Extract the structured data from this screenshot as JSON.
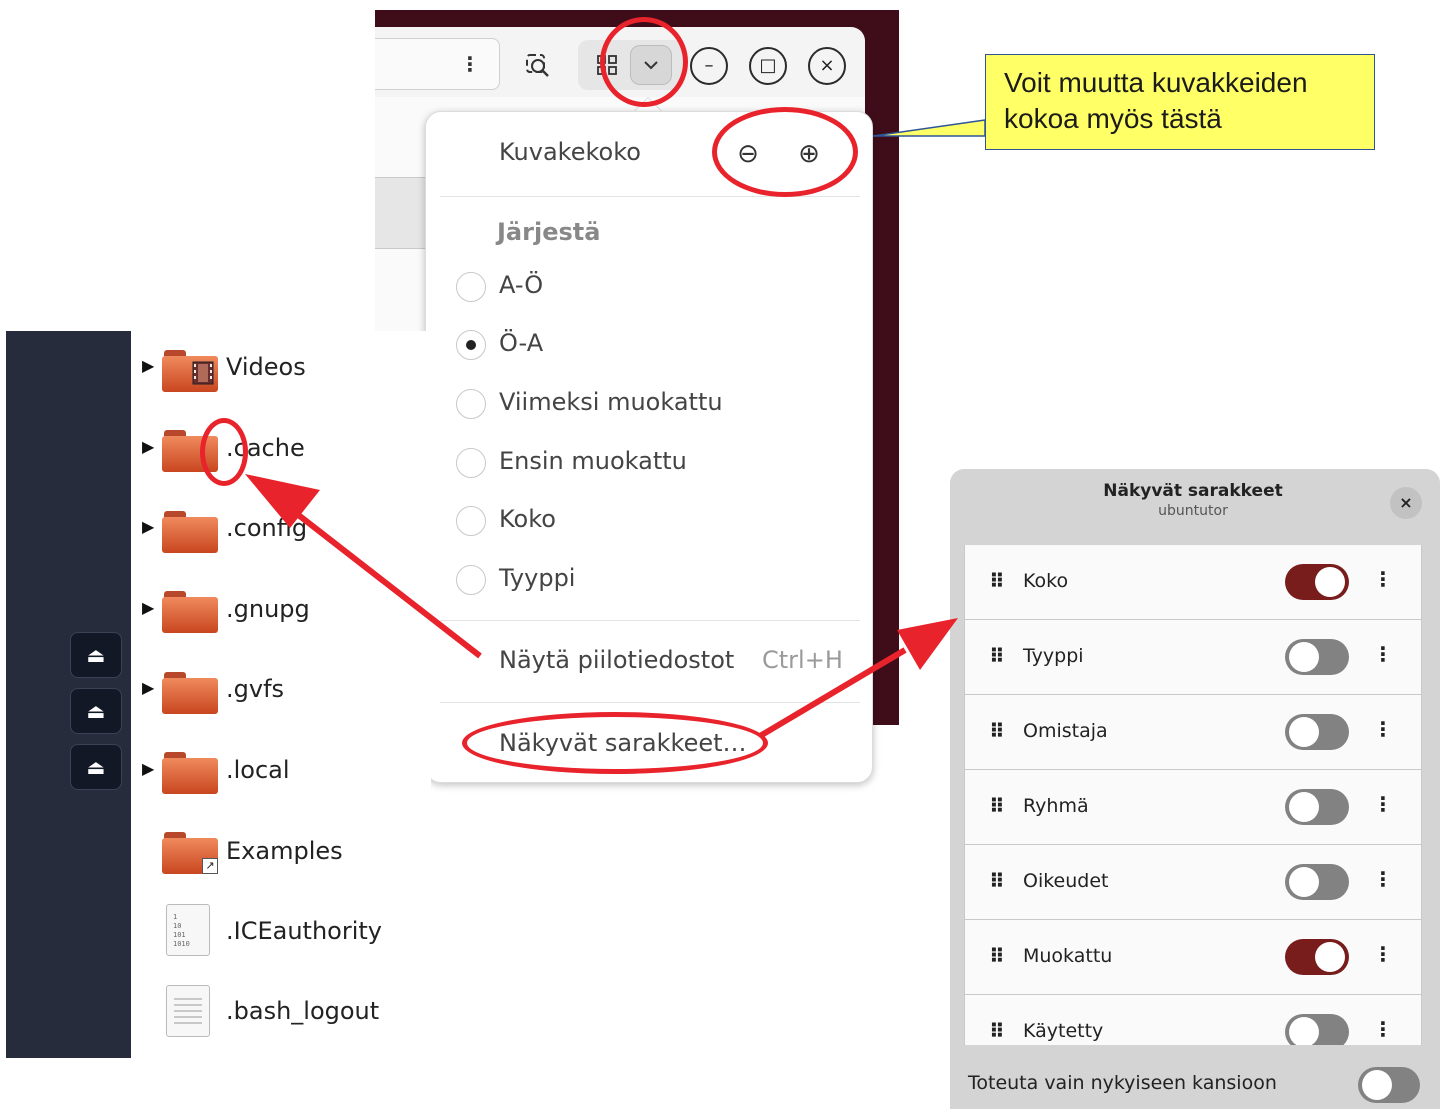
{
  "window": {
    "pathbar_menu_icon": "vertical-dots-icon",
    "search_icon": "search-icon",
    "view_grid_icon": "grid-view-icon",
    "view_menu_icon": "chevron-down-icon",
    "minimize_symbol": "–",
    "maximize_symbol": "□",
    "close_symbol": "×",
    "accent_color": "#3f0d1a"
  },
  "popover": {
    "icon_size_label": "Kuvakekoko",
    "zoom_out_symbol": "⊖",
    "zoom_in_symbol": "⊕",
    "sort_heading": "Järjestä",
    "sort_options": [
      {
        "label": "A-Ö",
        "checked": false
      },
      {
        "label": "Ö-A",
        "checked": true
      },
      {
        "label": "Viimeksi muokattu",
        "checked": false
      },
      {
        "label": "Ensin muokattu",
        "checked": false
      },
      {
        "label": "Koko",
        "checked": false
      },
      {
        "label": "Tyyppi",
        "checked": false
      }
    ],
    "show_hidden_label": "Näytä piilotiedostot",
    "show_hidden_shortcut": "Ctrl+H",
    "visible_columns_label": "Näkyvät sarakkeet…"
  },
  "file_list": {
    "items": [
      {
        "name": "Videos",
        "expandable": true,
        "icon": "folder-videos-icon"
      },
      {
        "name": ".cache",
        "expandable": true,
        "icon": "folder-icon"
      },
      {
        "name": ".config",
        "expandable": true,
        "icon": "folder-icon"
      },
      {
        "name": ".gnupg",
        "expandable": true,
        "icon": "folder-icon"
      },
      {
        "name": ".gvfs",
        "expandable": true,
        "icon": "folder-icon"
      },
      {
        "name": ".local",
        "expandable": true,
        "icon": "folder-icon"
      },
      {
        "name": "Examples",
        "expandable": false,
        "icon": "folder-link-icon"
      },
      {
        "name": ".ICEauthority",
        "expandable": false,
        "icon": "binary-file-icon"
      },
      {
        "name": ".bash_logout",
        "expandable": false,
        "icon": "text-file-icon"
      }
    ],
    "eject_symbol": "⏏"
  },
  "callout": {
    "line1": "Voit muutta kuvakkeiden",
    "line2": "kokoa myös tästä",
    "fill_color": "#ffff66"
  },
  "dialog": {
    "title": "Näkyvät sarakkeet",
    "subtitle": "ubuntutor",
    "close_symbol": "×",
    "columns": [
      {
        "label": "Koko",
        "enabled": true
      },
      {
        "label": "Tyyppi",
        "enabled": false
      },
      {
        "label": "Omistaja",
        "enabled": false
      },
      {
        "label": "Ryhmä",
        "enabled": false
      },
      {
        "label": "Oikeudet",
        "enabled": false
      },
      {
        "label": "Muokattu",
        "enabled": true
      },
      {
        "label": "Käytetty",
        "enabled": false
      }
    ],
    "footer_label": "Toteuta vain nykyiseen kansioon",
    "footer_enabled": false,
    "toggle_on_color": "#781c1c"
  },
  "annotation_color": "#e8232b"
}
